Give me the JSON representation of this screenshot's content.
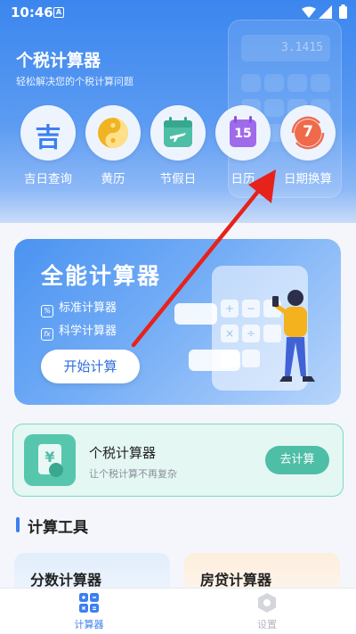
{
  "status_bar": {
    "time": "10:46",
    "notification_icon": "A"
  },
  "header": {
    "title": "个税计算器",
    "subtitle": "轻松解决您的个税计算问题",
    "calc_display": "3.1415"
  },
  "quick_actions": [
    {
      "label": "吉日查询",
      "icon": "ji-character-icon",
      "glyph": "吉"
    },
    {
      "label": "黄历",
      "icon": "yin-yang-icon"
    },
    {
      "label": "节假日",
      "icon": "calendar-plane-icon"
    },
    {
      "label": "日历",
      "icon": "calendar-15-icon",
      "glyph": "15"
    },
    {
      "label": "日期换算",
      "icon": "date-convert-icon",
      "glyph": "7"
    }
  ],
  "main_card": {
    "title": "全能计算器",
    "features": [
      {
        "label": "标准计算器",
        "icon_glyph": "%"
      },
      {
        "label": "科学计算器",
        "icon_glyph": "fx"
      }
    ],
    "button": "开始计算"
  },
  "tax_card": {
    "title": "个税计算器",
    "subtitle": "让个税计算不再复杂",
    "button": "去计算",
    "icon_glyph": "¥"
  },
  "section": {
    "title": "计算工具"
  },
  "tools": [
    {
      "label": "分数计算器"
    },
    {
      "label": "房贷计算器"
    }
  ],
  "bottom_nav": [
    {
      "label": "计算器",
      "active": true
    },
    {
      "label": "设置",
      "active": false
    }
  ],
  "colors": {
    "primary": "#3b86ee",
    "accent_green": "#4ebea6",
    "annotation_arrow": "#e5231b"
  }
}
